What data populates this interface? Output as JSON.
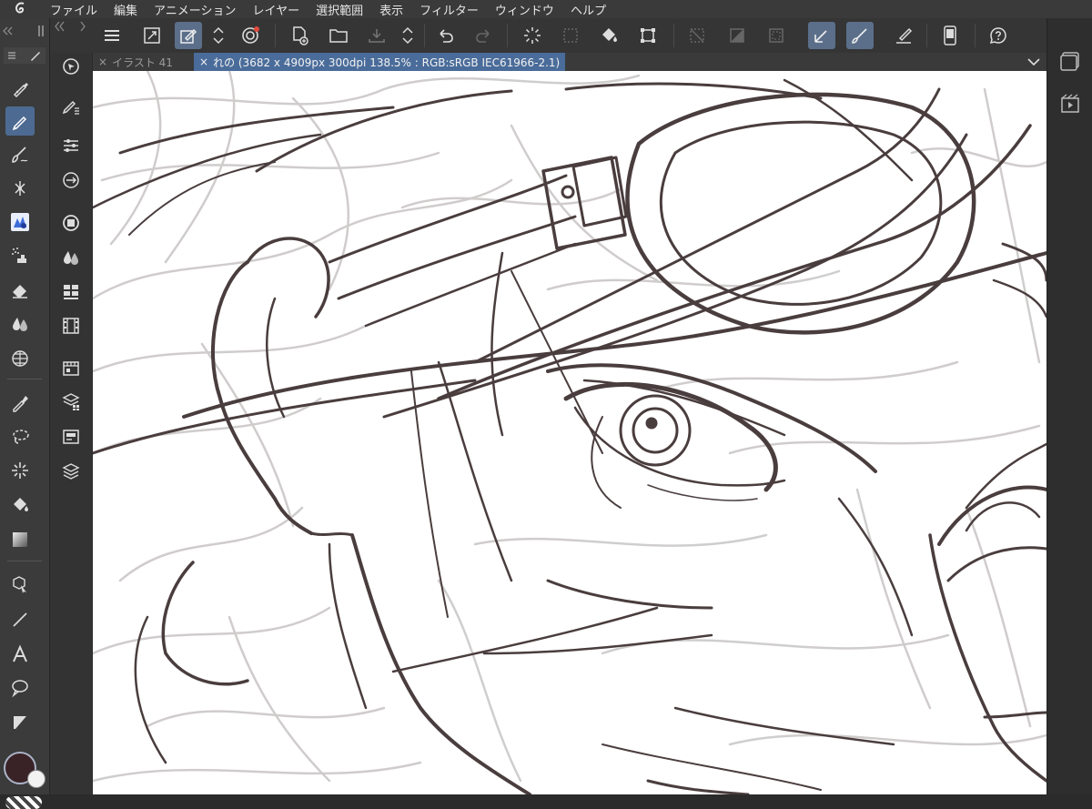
{
  "menubar": {
    "items": [
      "ファイル",
      "編集",
      "アニメーション",
      "レイヤー",
      "選択範囲",
      "表示",
      "フィルター",
      "ウィンドウ",
      "ヘルプ"
    ]
  },
  "tabs": [
    {
      "label": "イラスト 41",
      "close": "×"
    },
    {
      "label": "れの (3682 x 4909px 300dpi 138.5% : RGB:sRGB IEC61966-2.1)",
      "close": "×"
    }
  ],
  "toolbar": {
    "icons": [
      "menu-icon",
      "fit-view-icon",
      "edit-icon",
      "transform-icon",
      "new-layer-icon",
      "open-file-icon",
      "save-icon",
      "undo-icon",
      "redo-icon",
      "clear-selection-icon",
      "selection-icon",
      "fill-icon",
      "crop-icon",
      "reference-layer-icon",
      "layer-mask-icon",
      "canvas-icon",
      "brush-pen-icon",
      "brush-icon",
      "pen-ruler-icon",
      "mobile-icon",
      "help-icon"
    ]
  },
  "colors": {
    "accent": "#4d6a92",
    "main_color": "#3a2326",
    "sub_color": "#f2f2f2",
    "line_art": "#4a3d3e",
    "sketch": "#c8c4c4"
  }
}
